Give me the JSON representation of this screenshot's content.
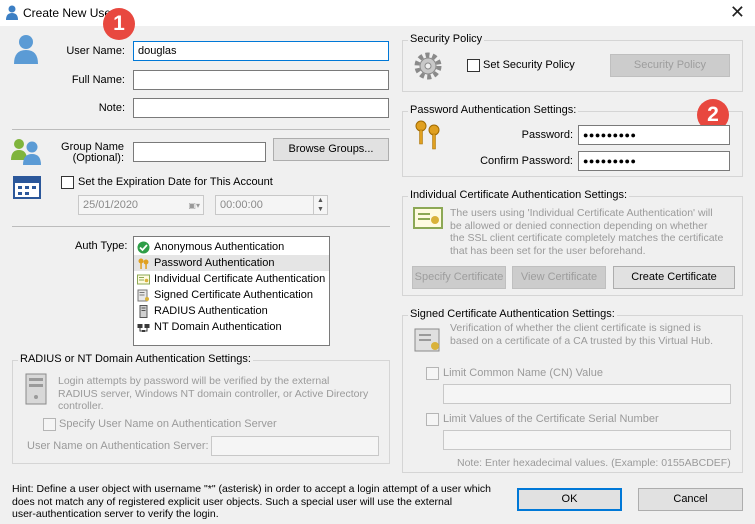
{
  "window": {
    "title": "Create New User",
    "close_symbol": "✕"
  },
  "badges": {
    "one": "1",
    "two": "2"
  },
  "user": {
    "username_label": "User Name:",
    "username_value": "douglas",
    "fullname_label": "Full Name:",
    "fullname_value": "",
    "note_label": "Note:",
    "note_value": ""
  },
  "group": {
    "label_line1": "Group Name",
    "label_line2": "(Optional):",
    "value": "",
    "browse_button": "Browse Groups..."
  },
  "expiration": {
    "checkbox_label": "Set the Expiration Date for This Account",
    "date": "25/01/2020",
    "time": "00:00:00"
  },
  "auth_type": {
    "label": "Auth Type:",
    "items": [
      {
        "label": "Anonymous Authentication",
        "icon": "green-check-icon",
        "selected": false
      },
      {
        "label": "Password Authentication",
        "icon": "keys-icon",
        "selected": true
      },
      {
        "label": "Individual Certificate Authentication",
        "icon": "certificate-icon",
        "selected": false
      },
      {
        "label": "Signed Certificate Authentication",
        "icon": "signed-certificate-icon",
        "selected": false
      },
      {
        "label": "RADIUS Authentication",
        "icon": "server-icon",
        "selected": false
      },
      {
        "label": "NT Domain Authentication",
        "icon": "network-icon",
        "selected": false
      }
    ]
  },
  "radius": {
    "title": "RADIUS or NT Domain Authentication Settings:",
    "desc_line1": "Login attempts by password will be verified by the external",
    "desc_line2": "RADIUS server, Windows NT domain controller, or Active Directory",
    "desc_line3": "controller.",
    "specify_checkbox": "Specify User Name on Authentication Server",
    "server_username_label": "User Name on Authentication Server:",
    "server_username_value": ""
  },
  "security_policy": {
    "title": "Security Policy",
    "checkbox_label": "Set Security Policy",
    "button": "Security Policy"
  },
  "password": {
    "title": "Password Authentication Settings:",
    "password_label": "Password:",
    "password_value": "●●●●●●●●●",
    "confirm_label": "Confirm Password:",
    "confirm_value": "●●●●●●●●●"
  },
  "individual_cert": {
    "title": "Individual Certificate Authentication Settings:",
    "desc_line1": "The users using 'Individual Certificate Authentication' will",
    "desc_line2": "be allowed or denied connection depending on whether",
    "desc_line3": "the SSL client certificate completely matches the certificate",
    "desc_line4": "that has been set for the user beforehand.",
    "specify_button": "Specify Certificate",
    "view_button": "View Certificate",
    "create_button": "Create Certificate"
  },
  "signed_cert": {
    "title": "Signed Certificate Authentication Settings:",
    "desc_line1": "Verification of whether the client certificate is signed is",
    "desc_line2": "based on a certificate of a CA trusted by this Virtual Hub.",
    "limit_cn_label": "Limit Common Name (CN) Value",
    "limit_cn_value": "",
    "limit_serial_label": "Limit Values of the Certificate Serial Number",
    "limit_serial_value": "",
    "serial_note": "Note: Enter hexadecimal values. (Example: 0155ABCDEF)"
  },
  "hint": {
    "line1": "Hint: Define a user object with username \"*\" (asterisk) in order to accept a login attempt of a user which",
    "line2": "does not match any of registered explicit user objects. Such a special user will use the external",
    "line3": "user-authentication server to verify the login."
  },
  "footer": {
    "ok_button": "OK",
    "cancel_button": "Cancel"
  },
  "colors": {
    "accent": "#0078d7",
    "badge": "#e8483f",
    "background": "#f0f0f0"
  }
}
